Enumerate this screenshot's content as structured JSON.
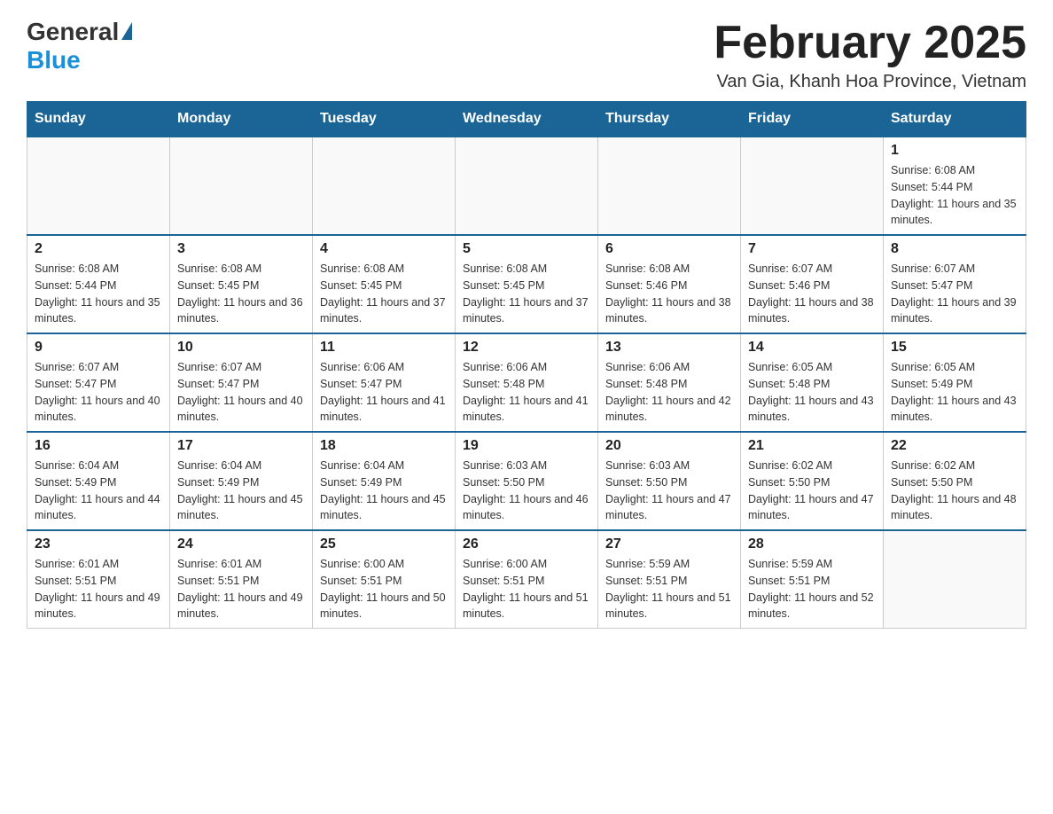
{
  "header": {
    "logo_general": "General",
    "logo_blue": "Blue",
    "month_title": "February 2025",
    "location": "Van Gia, Khanh Hoa Province, Vietnam"
  },
  "weekdays": [
    "Sunday",
    "Monday",
    "Tuesday",
    "Wednesday",
    "Thursday",
    "Friday",
    "Saturday"
  ],
  "weeks": [
    [
      {
        "day": "",
        "info": ""
      },
      {
        "day": "",
        "info": ""
      },
      {
        "day": "",
        "info": ""
      },
      {
        "day": "",
        "info": ""
      },
      {
        "day": "",
        "info": ""
      },
      {
        "day": "",
        "info": ""
      },
      {
        "day": "1",
        "info": "Sunrise: 6:08 AM\nSunset: 5:44 PM\nDaylight: 11 hours and 35 minutes."
      }
    ],
    [
      {
        "day": "2",
        "info": "Sunrise: 6:08 AM\nSunset: 5:44 PM\nDaylight: 11 hours and 35 minutes."
      },
      {
        "day": "3",
        "info": "Sunrise: 6:08 AM\nSunset: 5:45 PM\nDaylight: 11 hours and 36 minutes."
      },
      {
        "day": "4",
        "info": "Sunrise: 6:08 AM\nSunset: 5:45 PM\nDaylight: 11 hours and 37 minutes."
      },
      {
        "day": "5",
        "info": "Sunrise: 6:08 AM\nSunset: 5:45 PM\nDaylight: 11 hours and 37 minutes."
      },
      {
        "day": "6",
        "info": "Sunrise: 6:08 AM\nSunset: 5:46 PM\nDaylight: 11 hours and 38 minutes."
      },
      {
        "day": "7",
        "info": "Sunrise: 6:07 AM\nSunset: 5:46 PM\nDaylight: 11 hours and 38 minutes."
      },
      {
        "day": "8",
        "info": "Sunrise: 6:07 AM\nSunset: 5:47 PM\nDaylight: 11 hours and 39 minutes."
      }
    ],
    [
      {
        "day": "9",
        "info": "Sunrise: 6:07 AM\nSunset: 5:47 PM\nDaylight: 11 hours and 40 minutes."
      },
      {
        "day": "10",
        "info": "Sunrise: 6:07 AM\nSunset: 5:47 PM\nDaylight: 11 hours and 40 minutes."
      },
      {
        "day": "11",
        "info": "Sunrise: 6:06 AM\nSunset: 5:47 PM\nDaylight: 11 hours and 41 minutes."
      },
      {
        "day": "12",
        "info": "Sunrise: 6:06 AM\nSunset: 5:48 PM\nDaylight: 11 hours and 41 minutes."
      },
      {
        "day": "13",
        "info": "Sunrise: 6:06 AM\nSunset: 5:48 PM\nDaylight: 11 hours and 42 minutes."
      },
      {
        "day": "14",
        "info": "Sunrise: 6:05 AM\nSunset: 5:48 PM\nDaylight: 11 hours and 43 minutes."
      },
      {
        "day": "15",
        "info": "Sunrise: 6:05 AM\nSunset: 5:49 PM\nDaylight: 11 hours and 43 minutes."
      }
    ],
    [
      {
        "day": "16",
        "info": "Sunrise: 6:04 AM\nSunset: 5:49 PM\nDaylight: 11 hours and 44 minutes."
      },
      {
        "day": "17",
        "info": "Sunrise: 6:04 AM\nSunset: 5:49 PM\nDaylight: 11 hours and 45 minutes."
      },
      {
        "day": "18",
        "info": "Sunrise: 6:04 AM\nSunset: 5:49 PM\nDaylight: 11 hours and 45 minutes."
      },
      {
        "day": "19",
        "info": "Sunrise: 6:03 AM\nSunset: 5:50 PM\nDaylight: 11 hours and 46 minutes."
      },
      {
        "day": "20",
        "info": "Sunrise: 6:03 AM\nSunset: 5:50 PM\nDaylight: 11 hours and 47 minutes."
      },
      {
        "day": "21",
        "info": "Sunrise: 6:02 AM\nSunset: 5:50 PM\nDaylight: 11 hours and 47 minutes."
      },
      {
        "day": "22",
        "info": "Sunrise: 6:02 AM\nSunset: 5:50 PM\nDaylight: 11 hours and 48 minutes."
      }
    ],
    [
      {
        "day": "23",
        "info": "Sunrise: 6:01 AM\nSunset: 5:51 PM\nDaylight: 11 hours and 49 minutes."
      },
      {
        "day": "24",
        "info": "Sunrise: 6:01 AM\nSunset: 5:51 PM\nDaylight: 11 hours and 49 minutes."
      },
      {
        "day": "25",
        "info": "Sunrise: 6:00 AM\nSunset: 5:51 PM\nDaylight: 11 hours and 50 minutes."
      },
      {
        "day": "26",
        "info": "Sunrise: 6:00 AM\nSunset: 5:51 PM\nDaylight: 11 hours and 51 minutes."
      },
      {
        "day": "27",
        "info": "Sunrise: 5:59 AM\nSunset: 5:51 PM\nDaylight: 11 hours and 51 minutes."
      },
      {
        "day": "28",
        "info": "Sunrise: 5:59 AM\nSunset: 5:51 PM\nDaylight: 11 hours and 52 minutes."
      },
      {
        "day": "",
        "info": ""
      }
    ]
  ]
}
